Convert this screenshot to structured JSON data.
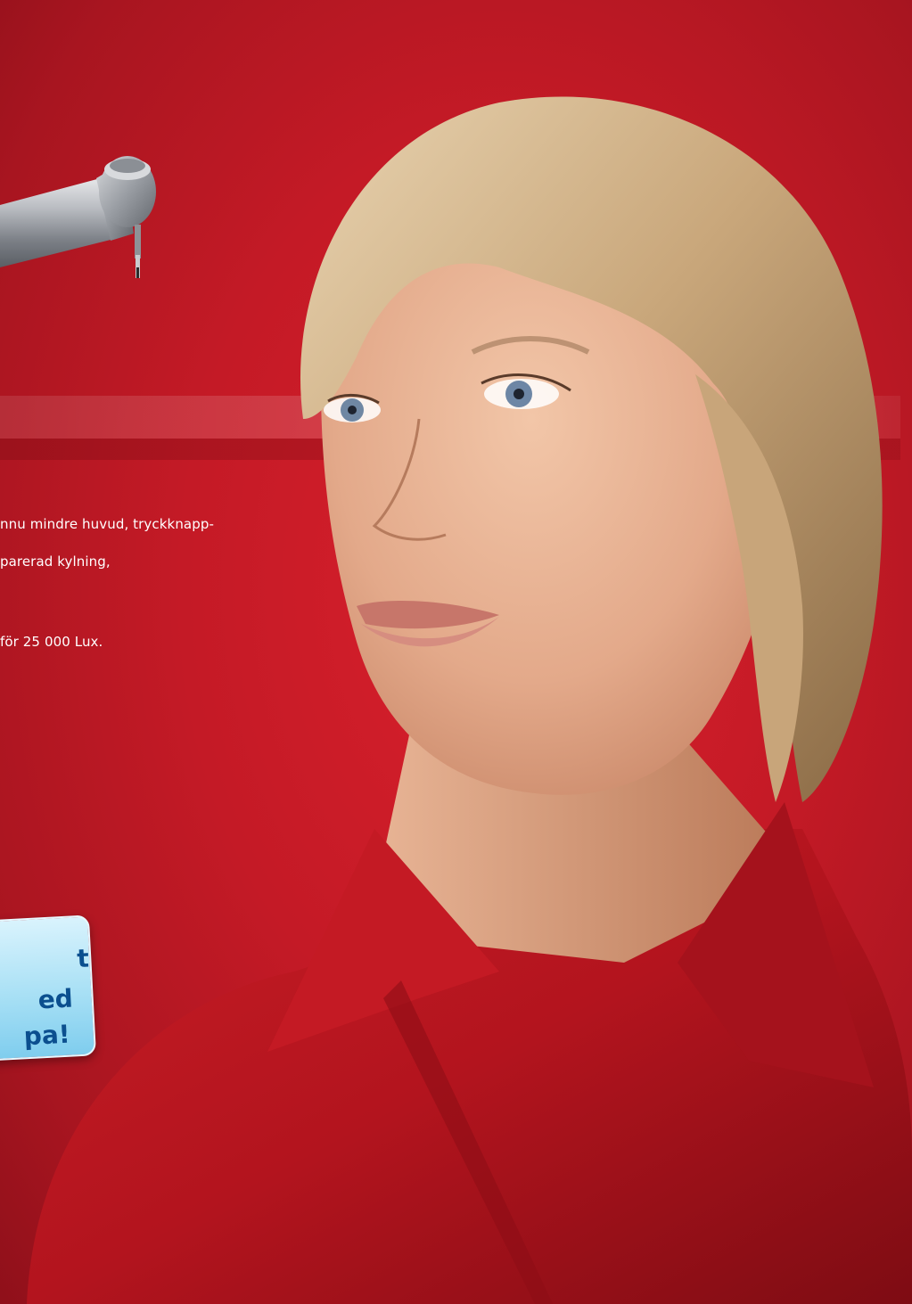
{
  "body_text": {
    "line1": "nnu mindre huvud, tryckknapp-",
    "line2": "parerad kylning,",
    "line3": "för 25 000 Lux."
  },
  "callout": {
    "line1": "t",
    "line2": "ed",
    "line3": "pa!"
  },
  "colors": {
    "background": "#c41a26",
    "callout_text": "#0b4f8f",
    "callout_fill": "#a8e0f5",
    "shirt": "#b3141e"
  },
  "images": {
    "handpiece": "dental-handpiece",
    "portrait": "woman-portrait-red-shirt"
  }
}
